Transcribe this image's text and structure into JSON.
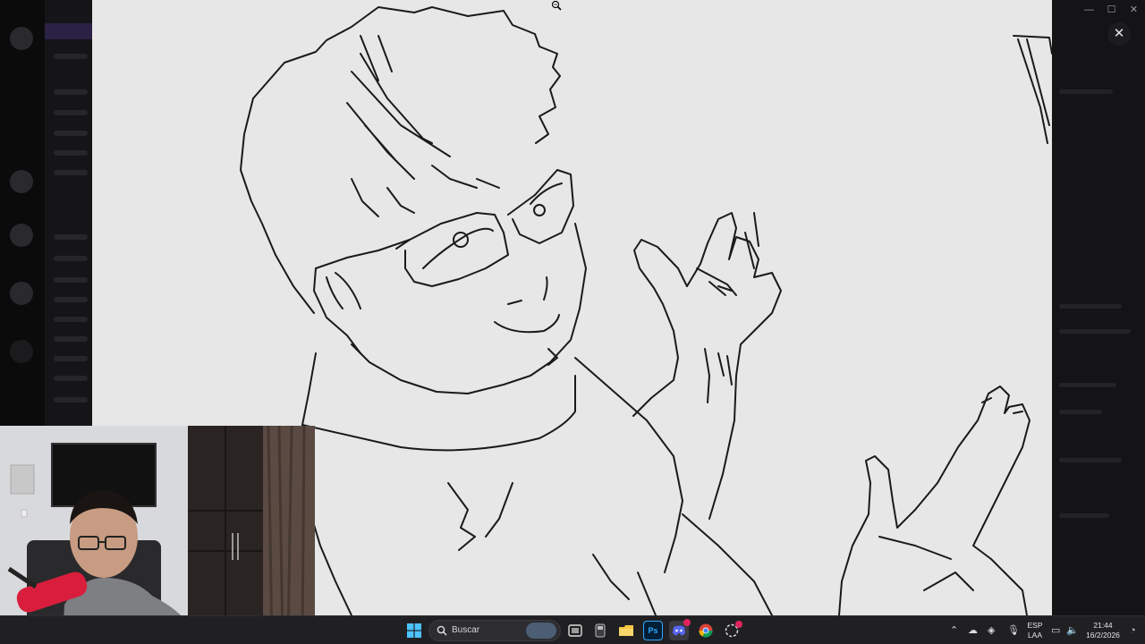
{
  "viewer": {
    "close_glyph": "✕",
    "image_subject": "pencil line drawing"
  },
  "taskbar": {
    "search_placeholder": "Buscar",
    "start_icon": "windows-start-icon",
    "pinned": [
      {
        "name": "task-view-icon"
      },
      {
        "name": "app-icon"
      },
      {
        "name": "file-explorer-icon"
      },
      {
        "name": "photoshop-icon",
        "label": "Ps"
      },
      {
        "name": "discord-icon"
      },
      {
        "name": "chrome-icon"
      },
      {
        "name": "app-notification-icon"
      }
    ],
    "tray": {
      "language_top": "ESP",
      "language_bottom": "LAA",
      "time": "21:44",
      "date": "16/2/2026"
    }
  },
  "colors": {
    "taskbar_bg": "#202023",
    "paper": "#e7e7e7",
    "ink": "#1a1a1a",
    "discord_accent": "#5865f2",
    "photoshop_accent": "#31a8ff"
  }
}
